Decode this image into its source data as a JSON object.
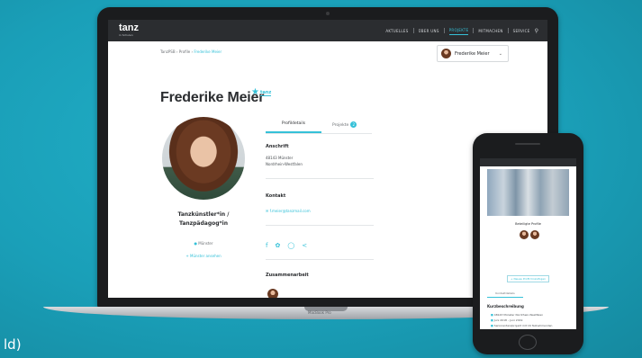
{
  "caption": "ld)",
  "laptop": {
    "brand_label": "MacBook Pro",
    "site": {
      "logo": "tanz",
      "logo_sub": "in Schulen",
      "nav": [
        "AKTUELLES",
        "ÜBER UNS",
        "PROJEKTE",
        "MITMACHEN",
        "SERVICE"
      ],
      "active_nav_index": 2,
      "breadcrumb": [
        "TanzPSB",
        "Profile",
        "Frederike Meier"
      ],
      "profile_switcher": {
        "name": "Frederike Meier"
      },
      "title": "Frederike Meier",
      "title_logo": "tanz",
      "role": [
        "Tanzkünstler*in /",
        "Tanzpädagog*in"
      ],
      "location": "Münster",
      "location_link": "+ Münster ansehen",
      "tabs": [
        {
          "label": "Profildetails"
        },
        {
          "label": "Projekte",
          "badge": "2"
        }
      ],
      "address_heading": "Anschrift",
      "address_lines": [
        "48143 Münster",
        "Nordrhein-Westfalen"
      ],
      "contact_heading": "Kontakt",
      "contact_email": "f.meier@tanzmail.com",
      "collab_heading": "Zusammenarbeit"
    }
  },
  "phone": {
    "profiles_label": "Beteiligte Profile",
    "button_label": "+ Neues Profil hinzufügen",
    "tab_label": "Kontaktdetails",
    "section_heading": "Kurzbeschreibung",
    "list": [
      "48143 Münster Nordrhein-Westfalen",
      "Juni 2018 – Juni 2019",
      "Seniorentanzprojekt mit 16 Teilnehmenden",
      "Münster"
    ]
  },
  "colors": {
    "accent": "#35c1d8",
    "background": "#1a9fb8",
    "device": "#1b1c1e"
  }
}
